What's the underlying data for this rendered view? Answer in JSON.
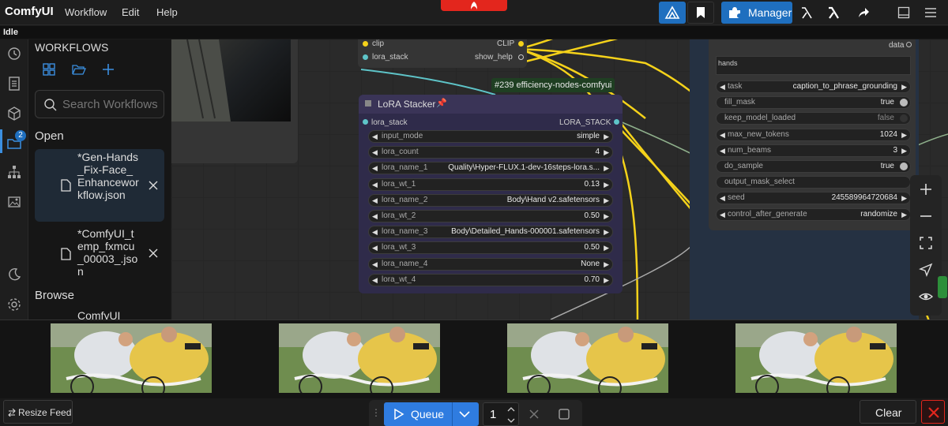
{
  "app": {
    "title": "ComfyUI",
    "status": "Idle"
  },
  "menu": {
    "items": [
      "Workflow",
      "Edit",
      "Help"
    ]
  },
  "topbar": {
    "manager_label": "Manager"
  },
  "sidebar": {
    "heading": "WORKFLOWS",
    "search_placeholder": "Search Workflows",
    "queue_badge": "2",
    "open_label": "Open",
    "browse_label": "Browse",
    "open_items": [
      {
        "name": "*Gen-Hands_Fix-Face_Enhanceworkflow.json"
      },
      {
        "name": "*ComfyUI_temp_fxmcu_00003_.json"
      }
    ],
    "browse_items": [
      {
        "name": "ComfyUI"
      }
    ]
  },
  "canvas": {
    "top_node": {
      "slots": {
        "clip": "clip",
        "clip_out": "CLIP",
        "lora_stack": "lora_stack",
        "show_help": "show_help"
      }
    },
    "badge": "#239 efficiency-nodes-comfyui",
    "lora_node": {
      "title": "LoRA Stacker",
      "pin": "📌",
      "input_slot": "lora_stack",
      "output_slot": "LORA_STACK",
      "widgets": [
        {
          "label": "input_mode",
          "value": "simple"
        },
        {
          "label": "lora_count",
          "value": "4"
        },
        {
          "label": "lora_name_1",
          "value": "Quality\\Hyper-FLUX.1-dev-16steps-lora.s..."
        },
        {
          "label": "lora_wt_1",
          "value": "0.13"
        },
        {
          "label": "lora_name_2",
          "value": "Body\\Hand v2.safetensors"
        },
        {
          "label": "lora_wt_2",
          "value": "0.50"
        },
        {
          "label": "lora_name_3",
          "value": "Body\\Detailed_Hands-000001.safetensors"
        },
        {
          "label": "lora_wt_3",
          "value": "0.50"
        },
        {
          "label": "lora_name_4",
          "value": "None"
        },
        {
          "label": "lora_wt_4",
          "value": "0.70"
        }
      ]
    },
    "florence_node": {
      "data_slot": "data",
      "text": "hands",
      "widgets": [
        {
          "label": "task",
          "value": "caption_to_phrase_grounding",
          "kind": "combo"
        },
        {
          "label": "fill_mask",
          "value": "true",
          "kind": "toggle",
          "on": true
        },
        {
          "label": "keep_model_loaded",
          "value": "false",
          "kind": "toggle",
          "on": false
        },
        {
          "label": "max_new_tokens",
          "value": "1024",
          "kind": "combo"
        },
        {
          "label": "num_beams",
          "value": "3",
          "kind": "combo"
        },
        {
          "label": "do_sample",
          "value": "true",
          "kind": "toggle",
          "on": true
        },
        {
          "label": "output_mask_select",
          "value": "",
          "kind": "text"
        },
        {
          "label": "seed",
          "value": "245589964720684",
          "kind": "combo"
        },
        {
          "label": "control_after_generate",
          "value": "randomize",
          "kind": "combo"
        }
      ]
    }
  },
  "feed": {
    "resize_label": "Resize Feed"
  },
  "queue": {
    "button_label": "Queue",
    "count": "1"
  },
  "bottom": {
    "clear_label": "Clear"
  },
  "colors": {
    "accent": "#1f6fbf",
    "danger": "#e3261d",
    "node_purple": "#2f2b4a",
    "wire_yellow": "#f5d21a"
  }
}
